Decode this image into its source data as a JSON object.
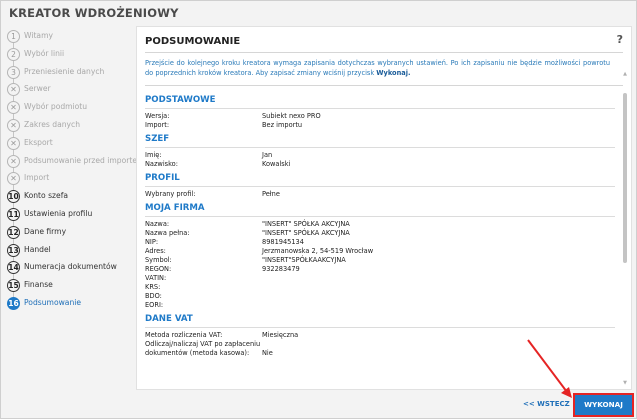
{
  "app": {
    "title": "KREATOR WDROŻENIOWY"
  },
  "steps": [
    {
      "num": "1",
      "label": "Witamy",
      "state": "pending"
    },
    {
      "num": "2",
      "label": "Wybór linii",
      "state": "pending"
    },
    {
      "num": "3",
      "label": "Przeniesienie danych",
      "state": "pending"
    },
    {
      "num": "",
      "label": "Serwer",
      "state": "skipped"
    },
    {
      "num": "",
      "label": "Wybór podmiotu",
      "state": "skipped"
    },
    {
      "num": "",
      "label": "Zakres danych",
      "state": "skipped"
    },
    {
      "num": "",
      "label": "Eksport",
      "state": "skipped"
    },
    {
      "num": "",
      "label": "Podsumowanie przed importem",
      "state": "skipped"
    },
    {
      "num": "",
      "label": "Import",
      "state": "skipped"
    },
    {
      "num": "10",
      "label": "Konto szefa",
      "state": "done"
    },
    {
      "num": "11",
      "label": "Ustawienia profilu",
      "state": "done"
    },
    {
      "num": "12",
      "label": "Dane firmy",
      "state": "done"
    },
    {
      "num": "13",
      "label": "Handel",
      "state": "done"
    },
    {
      "num": "14",
      "label": "Numeracja dokumentów",
      "state": "done"
    },
    {
      "num": "15",
      "label": "Finanse",
      "state": "done"
    },
    {
      "num": "16",
      "label": "Podsumowanie",
      "state": "active"
    }
  ],
  "panel": {
    "title": "PODSUMOWANIE",
    "help": "?",
    "intro_text": "Przejście do kolejnego kroku kreatora wymaga zapisania dotychczas wybranych ustawień. Po ich zapisaniu nie będzie możliwości powrotu do poprzednich kroków kreatora. Aby zapisać zmiany wciśnij przycisk ",
    "intro_bold": "Wykonaj."
  },
  "sections": [
    {
      "title": "PODSTAWOWE",
      "rows": [
        {
          "k": "Wersja:",
          "v": "Subiekt nexo PRO"
        },
        {
          "k": "Import:",
          "v": "Bez importu"
        }
      ]
    },
    {
      "title": "SZEF",
      "rows": [
        {
          "k": "Imię:",
          "v": "Jan"
        },
        {
          "k": "Nazwisko:",
          "v": "Kowalski"
        }
      ]
    },
    {
      "title": "PROFIL",
      "rows": [
        {
          "k": "Wybrany profil:",
          "v": "Pełne"
        }
      ]
    },
    {
      "title": "MOJA FIRMA",
      "rows": [
        {
          "k": "Nazwa:",
          "v": "\"INSERT\" SPÓŁKA AKCYJNA"
        },
        {
          "k": "Nazwa pełna:",
          "v": "\"INSERT\" SPÓŁKA AKCYJNA"
        },
        {
          "k": "NIP:",
          "v": "8981945134"
        },
        {
          "k": "Adres:",
          "v": "Jerzmanowska 2, 54-519 Wrocław"
        },
        {
          "k": "Symbol:",
          "v": "\"INSERT\"SPÓŁKAAKCYJNA"
        },
        {
          "k": "REGON:",
          "v": "932283479"
        },
        {
          "k": "VATIN:",
          "v": ""
        },
        {
          "k": "KRS:",
          "v": ""
        },
        {
          "k": "BDO:",
          "v": ""
        },
        {
          "k": "EORI:",
          "v": ""
        }
      ]
    },
    {
      "title": "DANE VAT",
      "rows": [
        {
          "k": "Metoda rozliczenia VAT:",
          "v": "Miesięczna"
        },
        {
          "k": "Odliczaj/naliczaj VAT po zapłaceniu",
          "v": ""
        },
        {
          "k": "dokumentów (metoda kasowa):",
          "v": "Nie"
        }
      ]
    }
  ],
  "footer": {
    "back_label": "<< WSTECZ",
    "run_label": "WYKONAJ"
  },
  "colors": {
    "accent": "#1f7ac8",
    "highlight": "#e52424"
  }
}
